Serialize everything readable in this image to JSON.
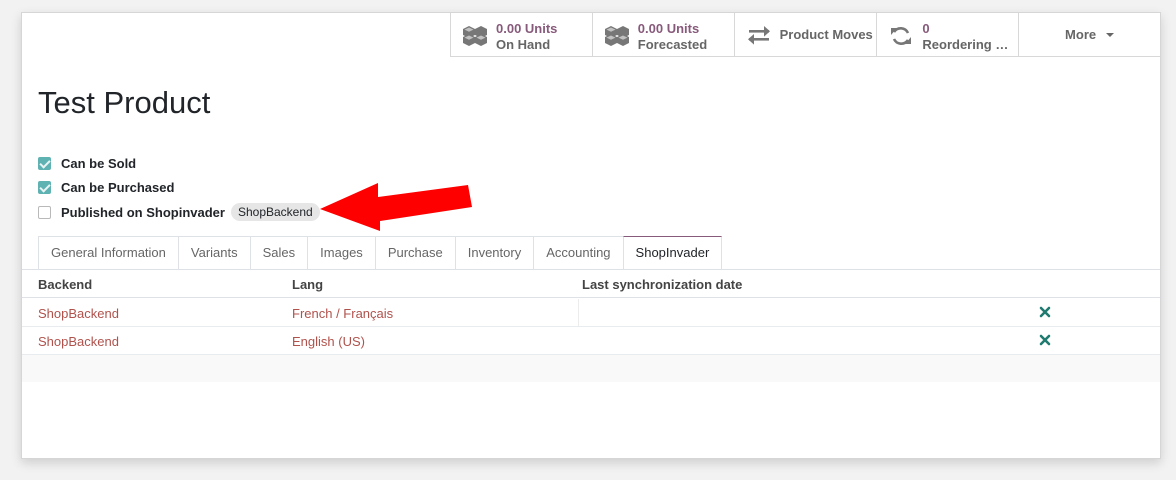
{
  "stat_buttons": [
    {
      "value": "0.00 Units",
      "label": "On Hand",
      "icon": "cubes-icon"
    },
    {
      "value": "0.00 Units",
      "label": "Forecasted",
      "icon": "cubes-icon"
    },
    {
      "label": "Product Moves",
      "icon": "exchange-icon"
    },
    {
      "value": "0",
      "label": "Reordering R...",
      "icon": "refresh-icon"
    }
  ],
  "more_label": "More",
  "product": {
    "title": "Test Product"
  },
  "options": [
    {
      "label": "Can be Sold",
      "checked": true
    },
    {
      "label": "Can be Purchased",
      "checked": true
    },
    {
      "label": "Published on Shopinvader",
      "checked": false,
      "badge": "ShopBackend"
    }
  ],
  "tabs": [
    "General Information",
    "Variants",
    "Sales",
    "Images",
    "Purchase",
    "Inventory",
    "Accounting",
    "ShopInvader"
  ],
  "active_tab": "ShopInvader",
  "table": {
    "headers": [
      "Backend",
      "Lang",
      "Last synchronization date"
    ],
    "rows": [
      {
        "backend": "ShopBackend",
        "lang": "French / Français",
        "last_sync": ""
      },
      {
        "backend": "ShopBackend",
        "lang": "English (US)",
        "last_sync": ""
      }
    ]
  },
  "colors": {
    "accent": "#875a7b",
    "link": "#b0524c",
    "checkbox": "#5fb2b2",
    "annotation_arrow": "#ff0000",
    "delete_icon": "#1f7a6f"
  }
}
